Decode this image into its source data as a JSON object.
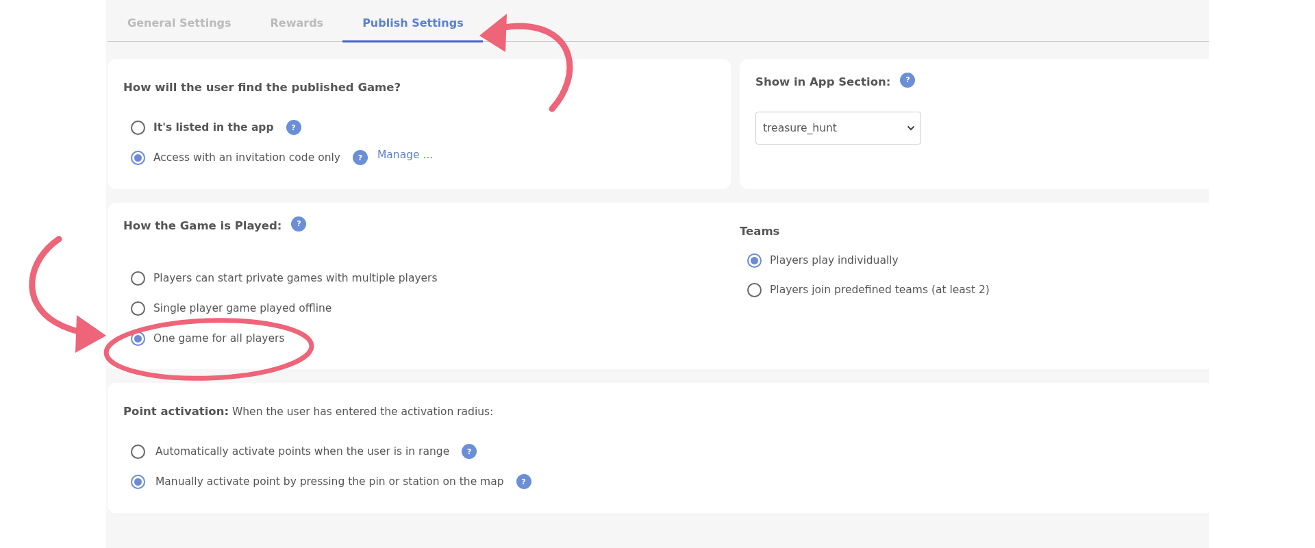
{
  "tabs": [
    {
      "label": "General Settings",
      "selected": false
    },
    {
      "label": "Rewards",
      "selected": false
    },
    {
      "label": "Publish Settings",
      "selected": true
    }
  ],
  "find_game": {
    "title": "How will the user find the published Game?",
    "options": [
      {
        "label": "It's listed in the app",
        "bold": true,
        "selected": false,
        "help": "?"
      },
      {
        "label": "Access with an invitation code only",
        "bold": false,
        "selected": true,
        "help": "?",
        "link": "Manage ..."
      }
    ]
  },
  "app_section": {
    "title": "Show in App Section:",
    "help": "?",
    "value": "treasure_hunt"
  },
  "game_played": {
    "title": "How the Game is Played:",
    "help": "?",
    "options": [
      {
        "label": "Players can start private games with multiple players",
        "selected": false
      },
      {
        "label": "Single player game played offline",
        "selected": false
      },
      {
        "label": "One game for all players",
        "selected": true
      }
    ]
  },
  "teams": {
    "title": "Teams",
    "options": [
      {
        "label": "Players play individually",
        "selected": true
      },
      {
        "label": "Players join predefined teams (at least 2)",
        "selected": false
      }
    ]
  },
  "point_activation": {
    "title": "**Point activation:** When the user has entered the activation radius:",
    "options": [
      {
        "label": "Automatically activate points when the user is in range",
        "selected": false,
        "help": "?"
      },
      {
        "label": "Manually activate point by pressing the pin or station on the map",
        "selected": true,
        "help": "?"
      }
    ]
  },
  "annotations": [
    {
      "kind": "tab-arrow"
    },
    {
      "kind": "side-arrow"
    },
    {
      "kind": "circle"
    }
  ]
}
